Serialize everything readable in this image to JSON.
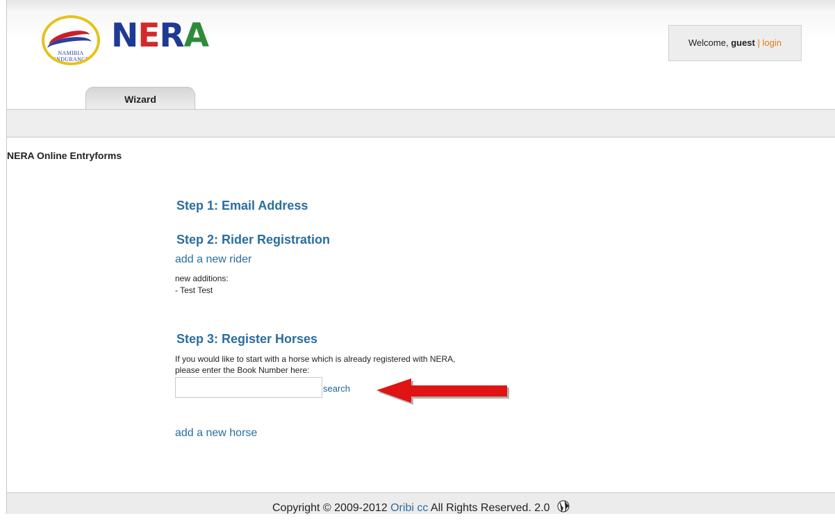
{
  "header": {
    "logo_text": "NAMIBIA ENDURANCE",
    "brand": "NERA",
    "welcome_prefix": "Welcome, ",
    "user": "guest",
    "separator": "|",
    "login_label": "login"
  },
  "tabs": [
    {
      "label": "Wizard"
    }
  ],
  "page_title": "NERA Online Entryforms",
  "steps": {
    "step1": {
      "title": "Step 1: Email Address"
    },
    "step2": {
      "title": "Step 2: Rider Registration",
      "add_link": "add a new rider",
      "additions_label": "new additions:",
      "additions": [
        "- Test Test"
      ]
    },
    "step3": {
      "title": "Step 3: Register Horses",
      "instruction_line1": "If you would like to start with a horse which is already registered with NERA,",
      "instruction_line2": "please enter the Book Number here:",
      "book_number_value": "",
      "search_label": "search",
      "add_link": "add a new horse"
    }
  },
  "footer": {
    "copyright_prefix": "Copyright © 2009-2012 ",
    "company_link": "Oribi cc",
    "copyright_suffix": " All Rights Reserved. 2.0"
  },
  "colors": {
    "link": "#2a6d9e",
    "login": "#e07a16",
    "annotation_arrow": "#e01414"
  },
  "icons": {
    "globe": "globe-icon",
    "annotation": "red-arrow-annotation"
  }
}
